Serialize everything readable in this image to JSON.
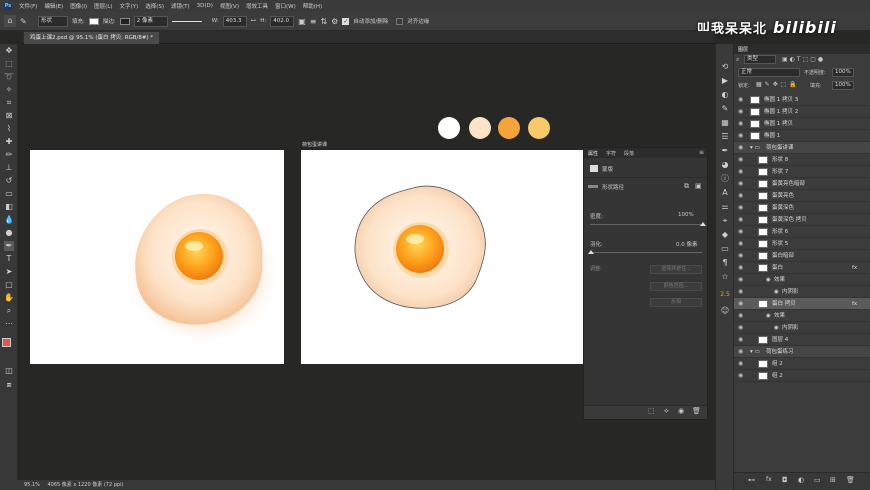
{
  "menu": {
    "logo": "Ps",
    "items": [
      "文件(F)",
      "编辑(E)",
      "图像(I)",
      "图层(L)",
      "文字(Y)",
      "选择(S)",
      "滤镜(T)",
      "3D(D)",
      "视图(V)",
      "增效工具",
      "窗口(W)",
      "帮助(H)"
    ]
  },
  "options": {
    "shape_mode": "形状",
    "fill_label": "填充:",
    "stroke_label": "描边:",
    "stroke_width": "2 像素",
    "w_label": "W:",
    "w_value": "403.3",
    "h_label": "H:",
    "h_value": "402.0",
    "auto_add": "自动添加/删除",
    "align_edges": "对齐边缘"
  },
  "watermark": {
    "text": "叫我呆呆北",
    "brand": "bilibili"
  },
  "document": {
    "tab_title": "鸡蛋上课2.psd @ 95.1% (蛋白 拷贝, RGB/8#) *",
    "artboard2_label": "荷包蛋讲课"
  },
  "colors": {
    "swatches": [
      "#ffffff",
      "#fde3c8",
      "#f5a33b",
      "#f6c96a"
    ],
    "panel_bg": "#3c3c3c",
    "canvas_bg": "#272826"
  },
  "status": {
    "zoom": "95.1%",
    "size": "4065 像素 x 1220 像素 (72 ppi)"
  },
  "properties": {
    "tabs": [
      "属性",
      "字符",
      "段落"
    ],
    "mask_title": "蒙版",
    "shape_path": "形状路径",
    "density_label": "密度:",
    "density_value": "100%",
    "feather_label": "羽化:",
    "feather_value": "0.0 像素",
    "adjust_label": "调整:",
    "btn_select": "选择并遮住...",
    "btn_color": "颜色范围...",
    "btn_invert": "反相"
  },
  "layers": {
    "tabs": [
      "图层"
    ],
    "filter_kind": "类型",
    "blend_mode": "正常",
    "opacity_label": "不透明度:",
    "opacity_value": "100%",
    "lock_label": "锁定:",
    "fill_label": "填充:",
    "fill_value": "100%",
    "rows": [
      {
        "name": "椭圆 1 拷贝 3",
        "indent": 0,
        "kind": "layer"
      },
      {
        "name": "椭圆 1 拷贝 2",
        "indent": 0,
        "kind": "layer"
      },
      {
        "name": "椭圆 1 拷贝",
        "indent": 0,
        "kind": "layer"
      },
      {
        "name": "椭圆 1",
        "indent": 0,
        "kind": "layer"
      },
      {
        "name": "荷包蛋讲课",
        "indent": 0,
        "kind": "group"
      },
      {
        "name": "形状 8",
        "indent": 1,
        "kind": "layer"
      },
      {
        "name": "形状 7",
        "indent": 1,
        "kind": "layer"
      },
      {
        "name": "蛋黄亮色暗部",
        "indent": 1,
        "kind": "layer"
      },
      {
        "name": "蛋黄亮色",
        "indent": 1,
        "kind": "layer"
      },
      {
        "name": "蛋黄深色",
        "indent": 1,
        "kind": "layer"
      },
      {
        "name": "蛋黄深色 拷贝",
        "indent": 1,
        "kind": "layer"
      },
      {
        "name": "形状 6",
        "indent": 1,
        "kind": "layer"
      },
      {
        "name": "形状 5",
        "indent": 1,
        "kind": "layer"
      },
      {
        "name": "蛋白暗部",
        "indent": 1,
        "kind": "layer"
      },
      {
        "name": "蛋白",
        "indent": 1,
        "kind": "fx"
      },
      {
        "name": "效果",
        "indent": 2,
        "kind": "effect"
      },
      {
        "name": "内阴影",
        "indent": 3,
        "kind": "effect"
      },
      {
        "name": "蛋白 拷贝",
        "indent": 1,
        "kind": "selfx"
      },
      {
        "name": "效果",
        "indent": 2,
        "kind": "effect"
      },
      {
        "name": "内阴影",
        "indent": 3,
        "kind": "effect"
      },
      {
        "name": "图层 4",
        "indent": 1,
        "kind": "layer"
      },
      {
        "name": "荷包蛋练习",
        "indent": 0,
        "kind": "group"
      },
      {
        "name": "组 2",
        "indent": 1,
        "kind": "layer"
      },
      {
        "name": "组 2",
        "indent": 1,
        "kind": "layer"
      }
    ]
  }
}
